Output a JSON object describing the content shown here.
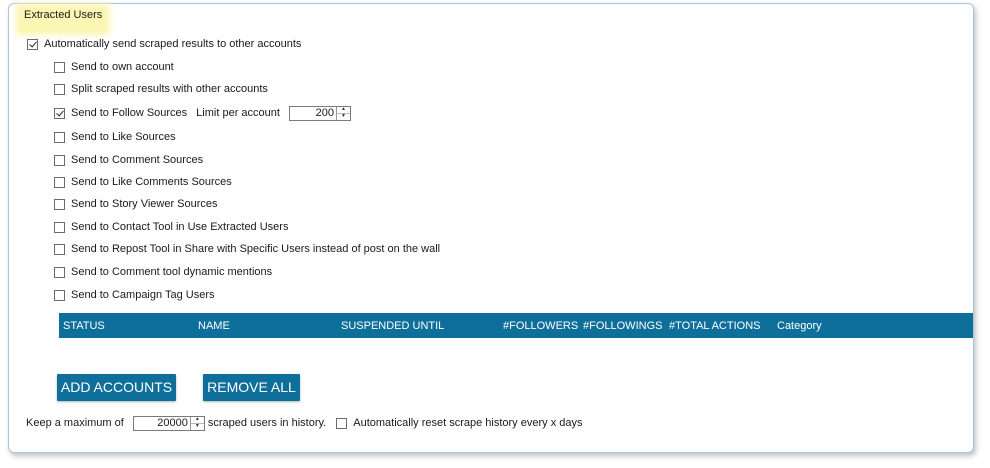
{
  "panel": {
    "title": "Extracted Users"
  },
  "auto_send": {
    "label": "Automatically send scraped results to other accounts",
    "checked": true
  },
  "options": [
    {
      "label": "Send to own account",
      "checked": false
    },
    {
      "label": "Split scraped results with other accounts",
      "checked": false
    },
    {
      "label": "Send to Follow Sources",
      "checked": true
    },
    {
      "label": "Send to Like Sources",
      "checked": false
    },
    {
      "label": "Send to Comment Sources",
      "checked": false
    },
    {
      "label": "Send to Like Comments Sources",
      "checked": false
    },
    {
      "label": "Send to Story Viewer Sources",
      "checked": false
    },
    {
      "label": "Send to Contact Tool in Use Extracted Users",
      "checked": false
    },
    {
      "label": "Send to Repost Tool in Share with Specific Users instead of post on the wall",
      "checked": false
    },
    {
      "label": "Send to Comment tool dynamic mentions",
      "checked": false
    },
    {
      "label": "Send to Campaign Tag Users",
      "checked": false
    }
  ],
  "limit": {
    "label": "Limit per account",
    "value": "200"
  },
  "grid": {
    "columns": [
      "STATUS",
      "NAME",
      "SUSPENDED UNTIL",
      "#FOLLOWERS",
      "#FOLLOWINGS",
      "#TOTAL ACTIONS",
      "Category"
    ]
  },
  "buttons": {
    "add_accounts": "ADD ACCOUNTS",
    "remove_all": "REMOVE ALL"
  },
  "history": {
    "prefix": "Keep a maximum of",
    "value": "20000",
    "suffix": "scraped users in history.",
    "reset_label": "Automatically reset scrape history every x days",
    "reset_checked": false
  },
  "colors": {
    "accent": "#0e6f9a",
    "legend_bg": "#fbf6b4",
    "panel_border": "#a9c4e0"
  }
}
